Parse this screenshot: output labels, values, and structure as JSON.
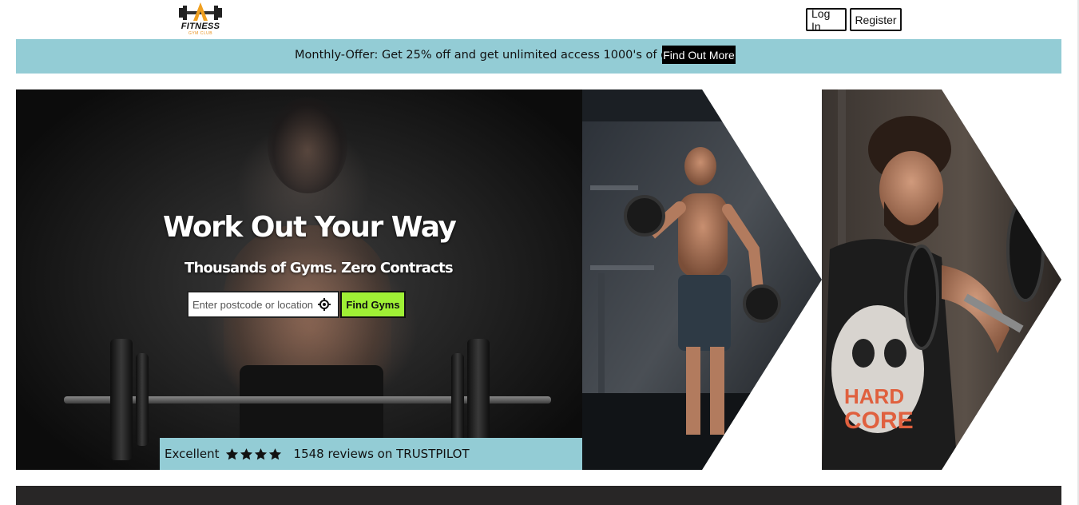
{
  "header": {
    "logo_text": "FITNESS",
    "logo_subtext": "GYM CLUB",
    "login_label": "Log In",
    "register_label": "Register"
  },
  "offer": {
    "text": "Monthly-Offer: Get 25% off and get unlimited access 1000's of gyms!",
    "button_label": "Find Out More",
    "bar_color": "#93ccd5"
  },
  "hero": {
    "title": "Work Out Your Way",
    "subtitle": "Thousands of Gyms. Zero Contracts",
    "search_placeholder": "Enter postcode or location",
    "search_button_label": "Find Gyms",
    "search_button_color": "#9ff035",
    "location_icon": "crosshair-icon"
  },
  "trust": {
    "rating_label": "Excellent",
    "stars": 4,
    "reviews_text": "1548 reviews on TRUSTPILOT"
  },
  "colors": {
    "accent_teal": "#93ccd5",
    "footer_dark": "#282626"
  }
}
